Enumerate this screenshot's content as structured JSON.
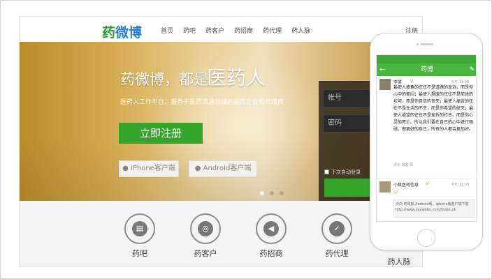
{
  "site": {
    "logo_part1": "药",
    "logo_part2": "微博",
    "nav": [
      "首页",
      "药吧",
      "药客户",
      "药招商",
      "药代理",
      "药人脉"
    ],
    "register_link": "注册"
  },
  "hero": {
    "slogan_main": "药微博，都是",
    "slogan_highlight": "医药人",
    "subtitle": "医药人工作平台，服务于医药流通领域的招商企业和代理商",
    "register_button": "立即注册",
    "iphone_button": "iPhone客户端",
    "android_button": "Android客户端",
    "carousel_dots": 3,
    "active_dot": 0
  },
  "login": {
    "account_placeholder": "帐号",
    "password_placeholder": "密码",
    "remember_label": "下次自动登录",
    "login_button": ""
  },
  "features": [
    "药吧",
    "药客户",
    "药招商",
    "药代理",
    "药人脉"
  ],
  "feature_icons": [
    "chat-icon",
    "search-person-icon",
    "megaphone-icon",
    "briefcase-icon",
    "group-icon"
  ],
  "phone": {
    "status_time": "",
    "app_title": "药博",
    "post1": {
      "user": "李笑",
      "time": "今天 11:08",
      "text": "最使人疲惫的往往不是道路的遥远，而是你心中的郁闷；最使人颓废的往往不是前途的坎坷，而是你自信的丧失；最使人痛苦的往往不是生活的不幸，而是你希望的破灭；最使人绝望的往往不是挫折的打击，而是你心灵的死亡。所以我们要在自己的心中进行强磁。做更好的自己，所有的人都会更加好。",
      "meta": "评论 转发 赞"
    },
    "post2": {
      "user": "小蕉医药信息",
      "time": "今天 11:08",
      "share_text": "次向 药周报 Android版，iphone版客户端下载 http://www.yaowebo.com/index.ph"
    }
  },
  "colors": {
    "brand_green": "#34a52b",
    "brand_blue": "#2a7fd1",
    "app_bar_green": "#4ab53e"
  }
}
